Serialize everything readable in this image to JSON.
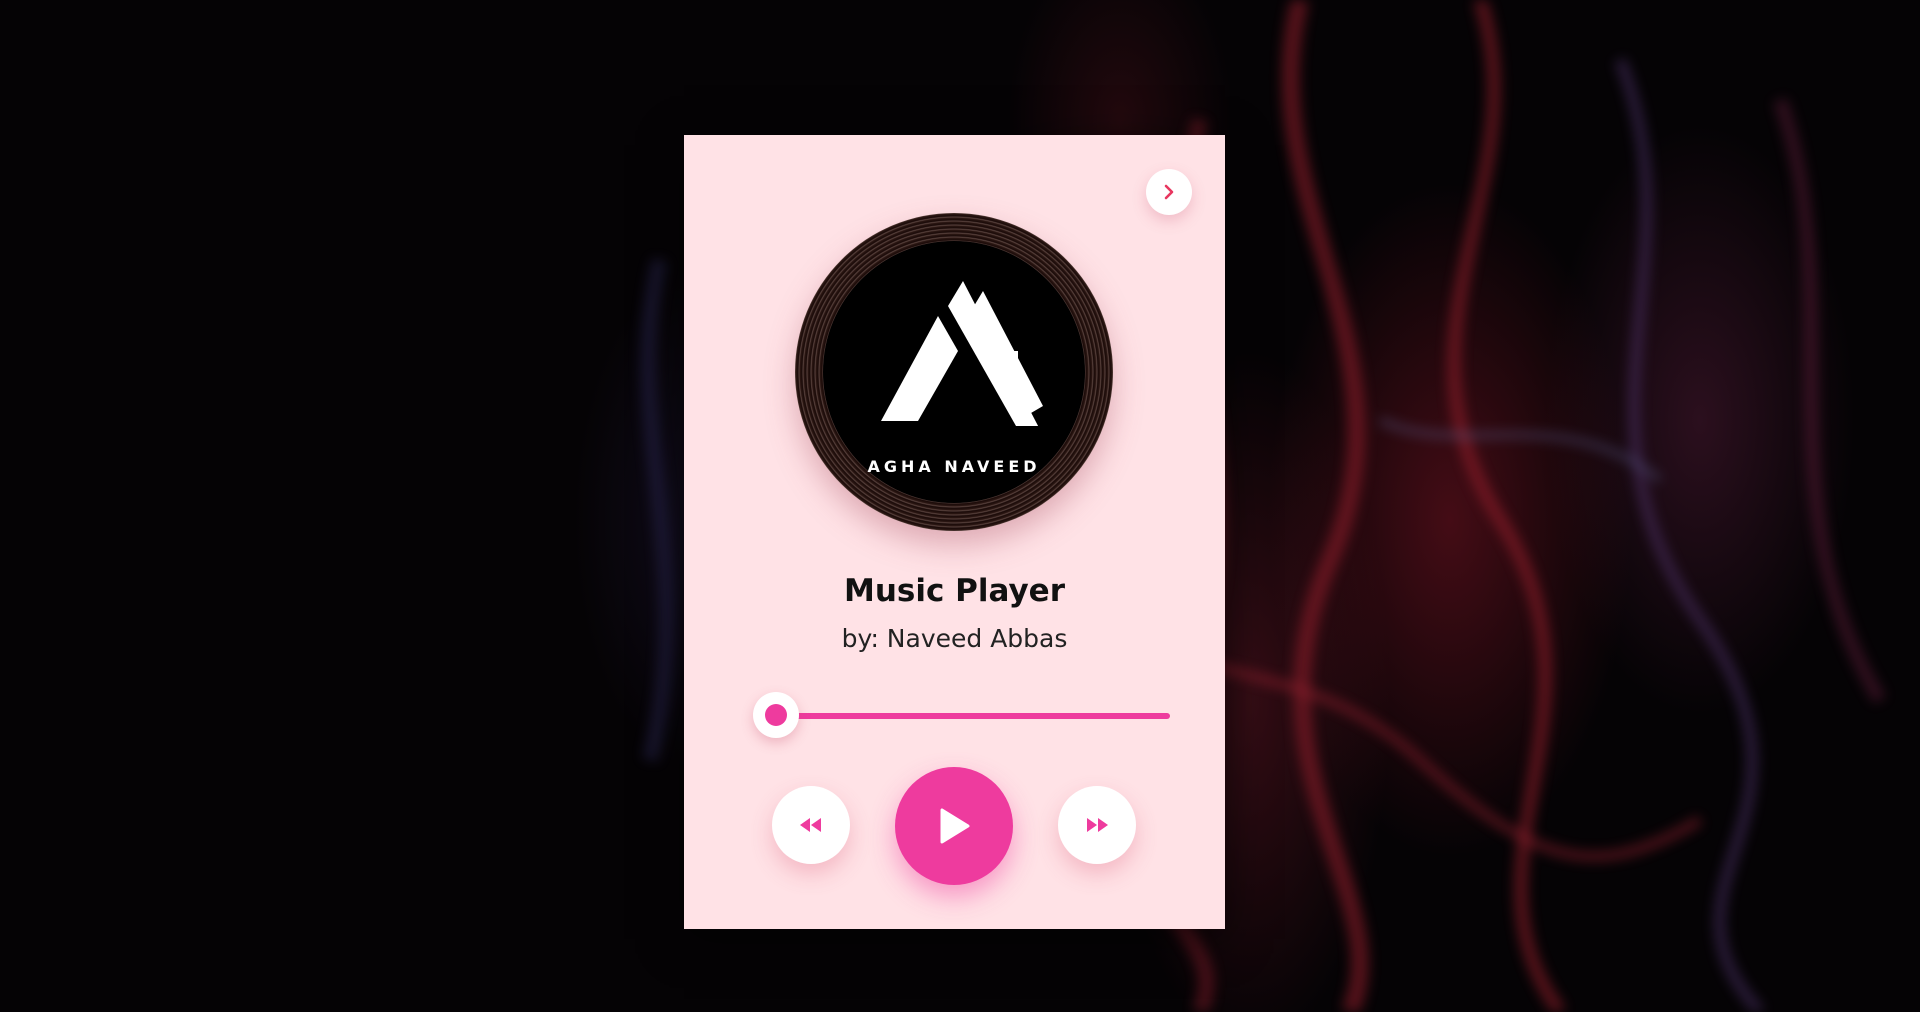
{
  "player": {
    "title": "Music Player",
    "artist": "by: Naveed Abbas",
    "cover_logo_text": "AGHA NAVEED",
    "progress": 0.03,
    "accent_color": "#ee3b9e",
    "card_color": "#ffe2e6"
  },
  "controls": {
    "top_button_icon": "chevron-right-icon",
    "prev_icon": "backward-icon",
    "play_icon": "play-icon",
    "next_icon": "forward-icon"
  }
}
